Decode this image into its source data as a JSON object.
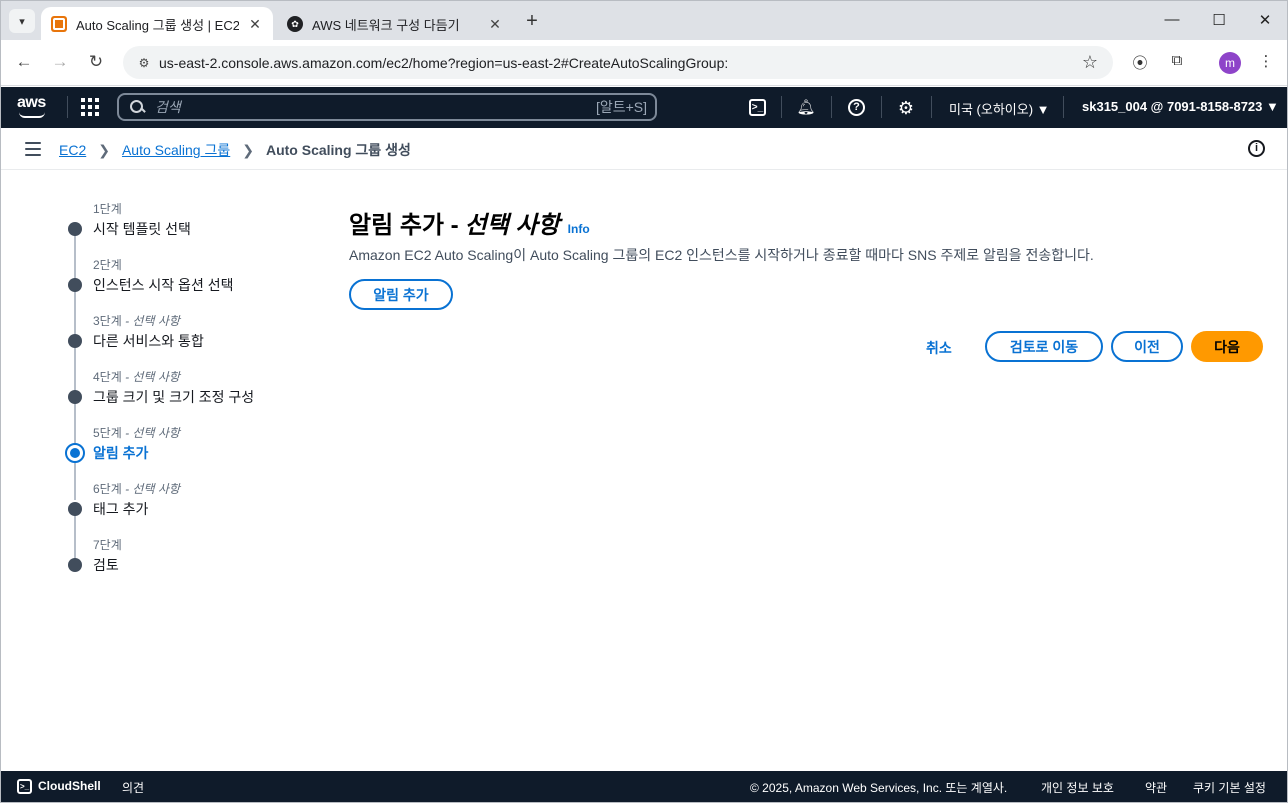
{
  "browser": {
    "tabs": [
      {
        "title": "Auto Scaling 그룹 생성 | EC2 |",
        "active": true
      },
      {
        "title": "AWS 네트워크 구성 다듬기",
        "active": false
      }
    ],
    "new_tab": "+",
    "url": "us-east-2.console.aws.amazon.com/ec2/home?region=us-east-2#CreateAutoScalingGroup:",
    "profile_initial": "m"
  },
  "aws_nav": {
    "logo": "aws",
    "search_placeholder": "검색",
    "search_shortcut": "[알트+S]",
    "region": "미국 (오하이오) ▼",
    "account": "sk315_004 @ 7091-8158-8723 ▼"
  },
  "breadcrumb": {
    "items": [
      "EC2",
      "Auto Scaling 그룹"
    ],
    "current": "Auto Scaling 그룹 생성"
  },
  "steps": [
    {
      "num": "1단계",
      "optional": "",
      "label": "시작 템플릿 선택",
      "active": false
    },
    {
      "num": "2단계",
      "optional": "",
      "label": "인스턴스 시작 옵션 선택",
      "active": false
    },
    {
      "num": "3단계",
      "optional": " - 선택 사항",
      "label": "다른 서비스와 통합",
      "active": false
    },
    {
      "num": "4단계",
      "optional": " - 선택 사항",
      "label": "그룹 크기 및 크기 조정 구성",
      "active": false
    },
    {
      "num": "5단계",
      "optional": " - 선택 사항",
      "label": "알림 추가",
      "active": true
    },
    {
      "num": "6단계",
      "optional": " - 선택 사항",
      "label": "태그 추가",
      "active": false
    },
    {
      "num": "7단계",
      "optional": "",
      "label": "검토",
      "active": false
    }
  ],
  "main": {
    "title": "알림 추가 -",
    "title_optional": "선택 사항",
    "info": "Info",
    "description": "Amazon EC2 Auto Scaling이 Auto Scaling 그룹의 EC2 인스턴스를 시작하거나 종료할 때마다 SNS 주제로 알림을 전송합니다.",
    "add_notification": "알림 추가",
    "cancel": "취소",
    "skip_to_review": "검토로 이동",
    "previous": "이전",
    "next": "다음"
  },
  "footer": {
    "cloudshell": "CloudShell",
    "feedback": "의견",
    "copyright": "© 2025, Amazon Web Services, Inc. 또는 계열사.",
    "privacy": "개인 정보 보호",
    "terms": "약관",
    "cookies": "쿠키 기본 설정"
  },
  "colors": {
    "aws_nav_bg": "#0f1b2a",
    "link": "#0972d3",
    "primary_button": "#ff9900"
  }
}
